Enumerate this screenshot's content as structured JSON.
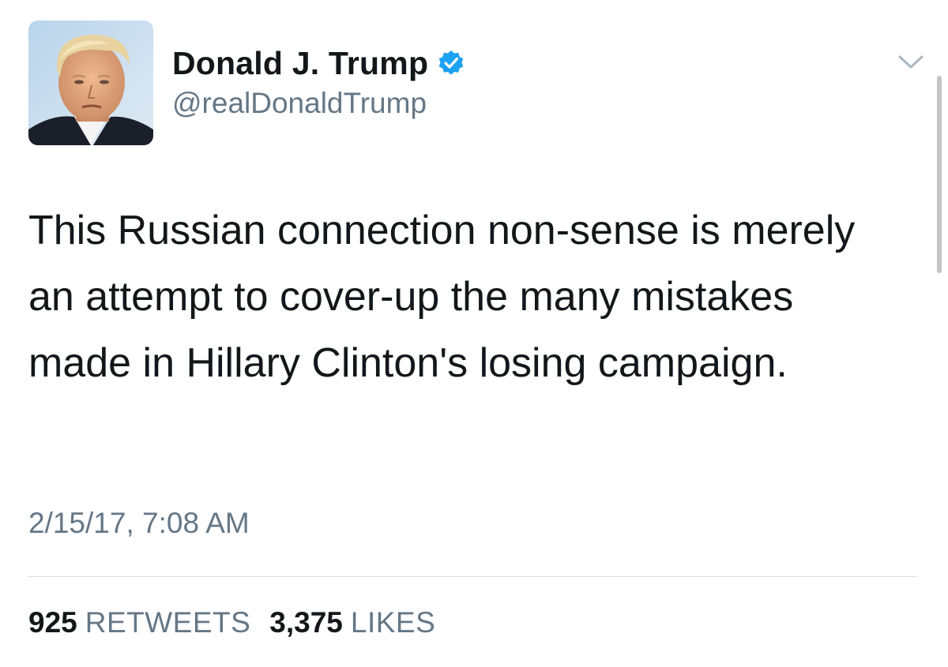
{
  "user": {
    "display_name": "Donald J. Trump",
    "handle": "@realDonaldTrump",
    "verified": true,
    "avatar_icon": "profile-photo"
  },
  "tweet": {
    "text": "This Russian connection non-sense is merely an attempt to cover-up the many mistakes made in Hillary Clinton's losing campaign.",
    "timestamp": "2/15/17, 7:08 AM"
  },
  "stats": {
    "retweets_count": "925",
    "retweets_label": "RETWEETS",
    "likes_count": "3,375",
    "likes_label": "LIKES"
  },
  "icons": {
    "verified": "verified-badge-icon",
    "menu": "chevron-down-icon"
  },
  "colors": {
    "verified_blue": "#1da1f2",
    "text_primary": "#14171a",
    "text_secondary": "#657786",
    "divider": "#d8dde1"
  }
}
